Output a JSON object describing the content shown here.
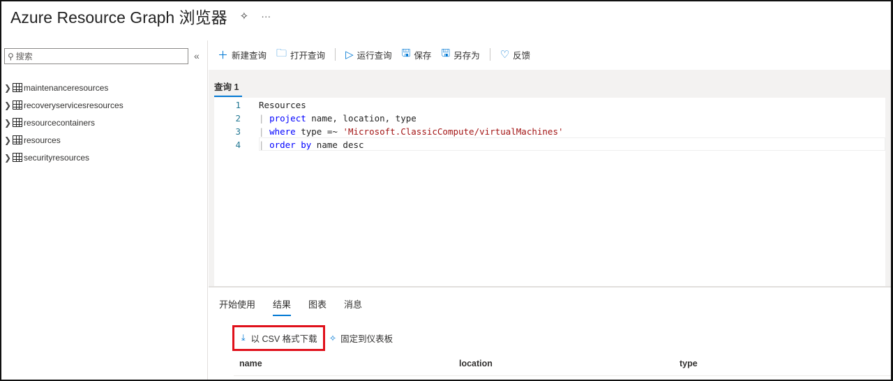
{
  "title": "Azure Resource Graph 浏览器",
  "title_more": "···",
  "sidebar": {
    "search_placeholder": "搜索",
    "collapse": "«",
    "tree": [
      "maintenanceresources",
      "recoveryservicesresources",
      "resourcecontainers",
      "resources",
      "securityresources"
    ]
  },
  "toolbar": {
    "new_query": "新建查询",
    "open_query": "打开查询",
    "run_query": "运行查询",
    "save": "保存",
    "save_as": "另存为",
    "feedback": "反馈"
  },
  "editor": {
    "tab": "查询 1",
    "lines": [
      {
        "n": "1",
        "parts": [
          {
            "t": "Resources",
            "c": ""
          }
        ]
      },
      {
        "n": "2",
        "parts": [
          {
            "t": "| ",
            "c": "bar"
          },
          {
            "t": "project",
            "c": "kw"
          },
          {
            "t": " name, location, type",
            "c": ""
          }
        ]
      },
      {
        "n": "3",
        "parts": [
          {
            "t": "| ",
            "c": "bar"
          },
          {
            "t": "where",
            "c": "kw"
          },
          {
            "t": " type =~ ",
            "c": ""
          },
          {
            "t": "'Microsoft.ClassicCompute/virtualMachines'",
            "c": "str"
          }
        ]
      },
      {
        "n": "4",
        "parts": [
          {
            "t": "| ",
            "c": "bar"
          },
          {
            "t": "order by",
            "c": "kw"
          },
          {
            "t": " name desc",
            "c": ""
          }
        ]
      }
    ]
  },
  "results": {
    "tabs": [
      "开始使用",
      "结果",
      "图表",
      "消息"
    ],
    "active_tab": "结果",
    "download_csv": "以 CSV 格式下载",
    "pin_dashboard": "固定到仪表板",
    "columns": [
      "name",
      "location",
      "type"
    ]
  },
  "colors": {
    "accent": "#0078d4",
    "highlight": "#e0101a"
  }
}
